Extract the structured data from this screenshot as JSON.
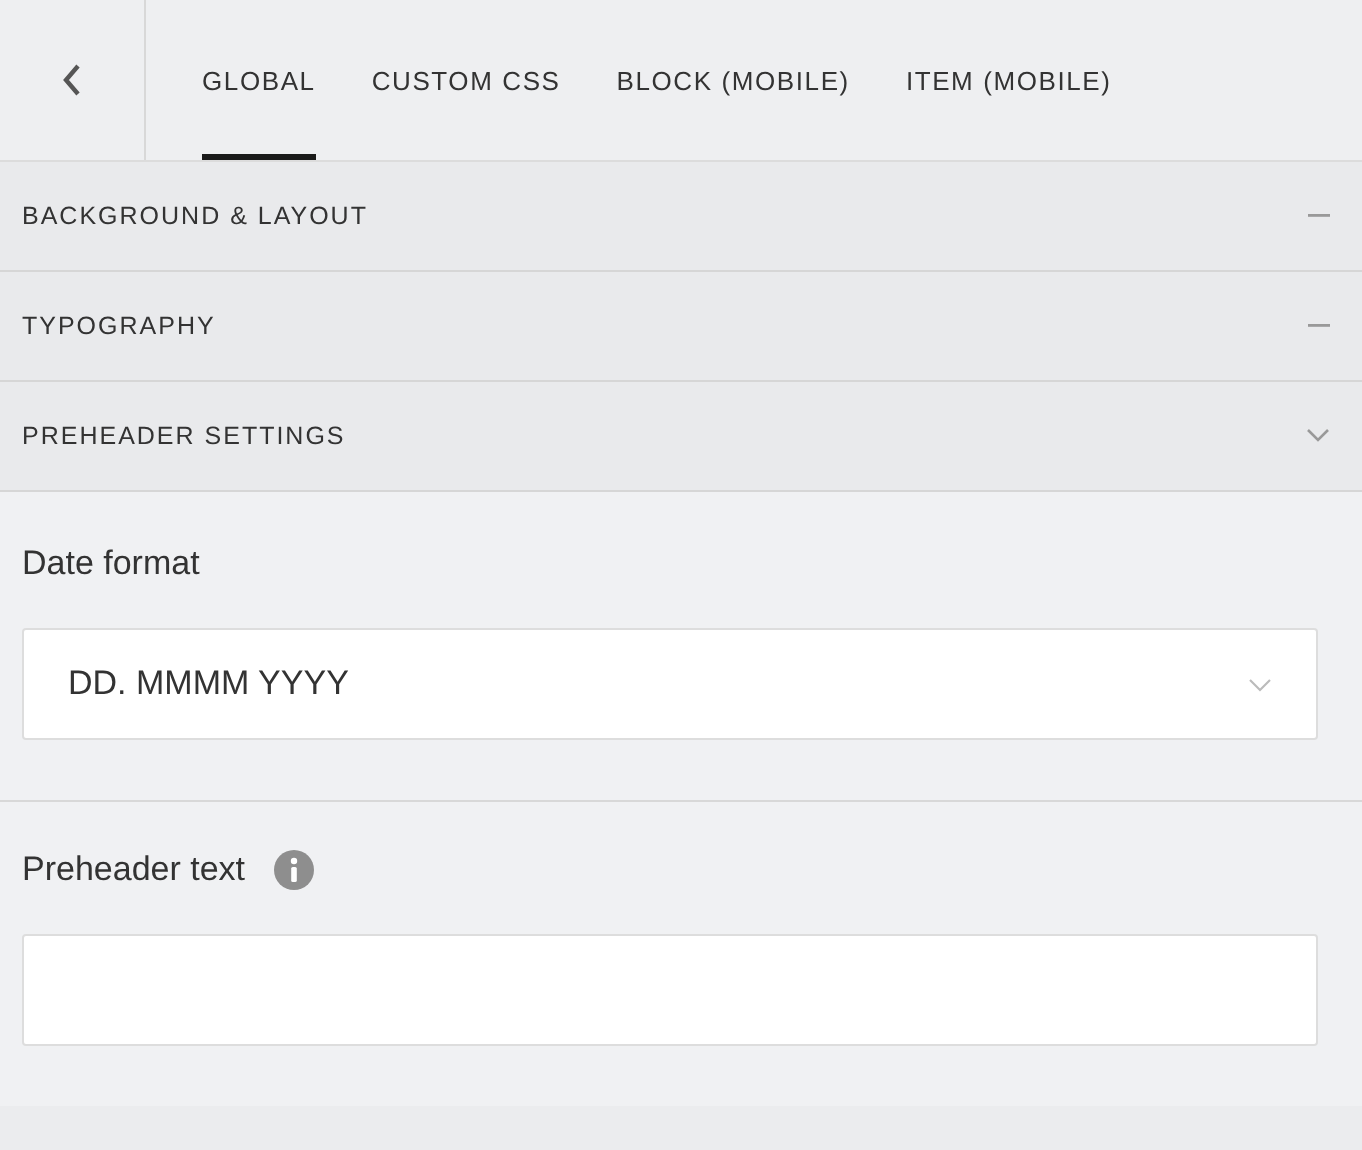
{
  "tabs": [
    {
      "label": "GLOBAL",
      "selected": true
    },
    {
      "label": "CUSTOM CSS",
      "selected": false
    },
    {
      "label": "BLOCK (MOBILE)",
      "selected": false
    },
    {
      "label": "ITEM (MOBILE)",
      "selected": false
    }
  ],
  "sections": [
    {
      "title": "BACKGROUND & LAYOUT",
      "expanded": false
    },
    {
      "title": "TYPOGRAPHY",
      "expanded": false
    },
    {
      "title": "PREHEADER SETTINGS",
      "expanded": true
    }
  ],
  "date_format": {
    "label": "Date format",
    "value": "DD. MMMM YYYY"
  },
  "preheader_text": {
    "label": "Preheader text"
  }
}
